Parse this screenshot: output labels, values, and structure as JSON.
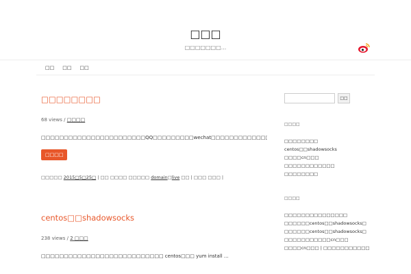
{
  "header": {
    "site_title": "□□□",
    "site_description": "□□□□□□□...",
    "weibo_icon": "weibo-icon"
  },
  "nav": {
    "items": [
      "□□",
      "□□",
      "□□"
    ]
  },
  "posts": [
    {
      "title": "□□□□□□□□",
      "views": "68 views",
      "meta_sep": "/",
      "meta_link": "□□□□",
      "excerpt": "□□□□□□□□□□□□□□□□□□□□□□□QQ□□□□□□□□□wechat□□□□□□□□□□□□□□□□...",
      "more": "□□□□",
      "foot_prefix": "□□□□□",
      "foot_date": "2015□5□25□",
      "foot_rest": " | □□ □□□□ □□□□□ ",
      "foot_link1": "domain",
      "foot_link2": "live",
      "foot_tail": " □□ | □□□ □□□ |"
    },
    {
      "title": "centos□□shadowsocks",
      "views": "238 views",
      "meta_sep": "/",
      "meta_link": "2 □□□",
      "excerpt": "□□□□□□□□□□□□□□□□□□□□□□□□□□□ centos□□□ yum install ..."
    }
  ],
  "sidebar": {
    "search_placeholder": "",
    "search_button": "□□",
    "widget1": {
      "title": "□□□□",
      "items": [
        "□□□□□□□□",
        "centos□□shadowsocks",
        "□□□□cn□□□",
        "□□□□□□□□□□□□",
        "□□□□□□□□"
      ]
    },
    "widget2": {
      "title": "□□□□",
      "items": [
        "□□□□□□□□□□□□□□□",
        "□□□□□□centos□□shadowsocks□",
        "□□□□□□centos□□shadowsocks□",
        "□□□□□□□□□□□cn□□□",
        "□□□□cn□□□ | □□□□□□□□□□□"
      ]
    }
  },
  "colors": {
    "accent": "#e8572a"
  }
}
